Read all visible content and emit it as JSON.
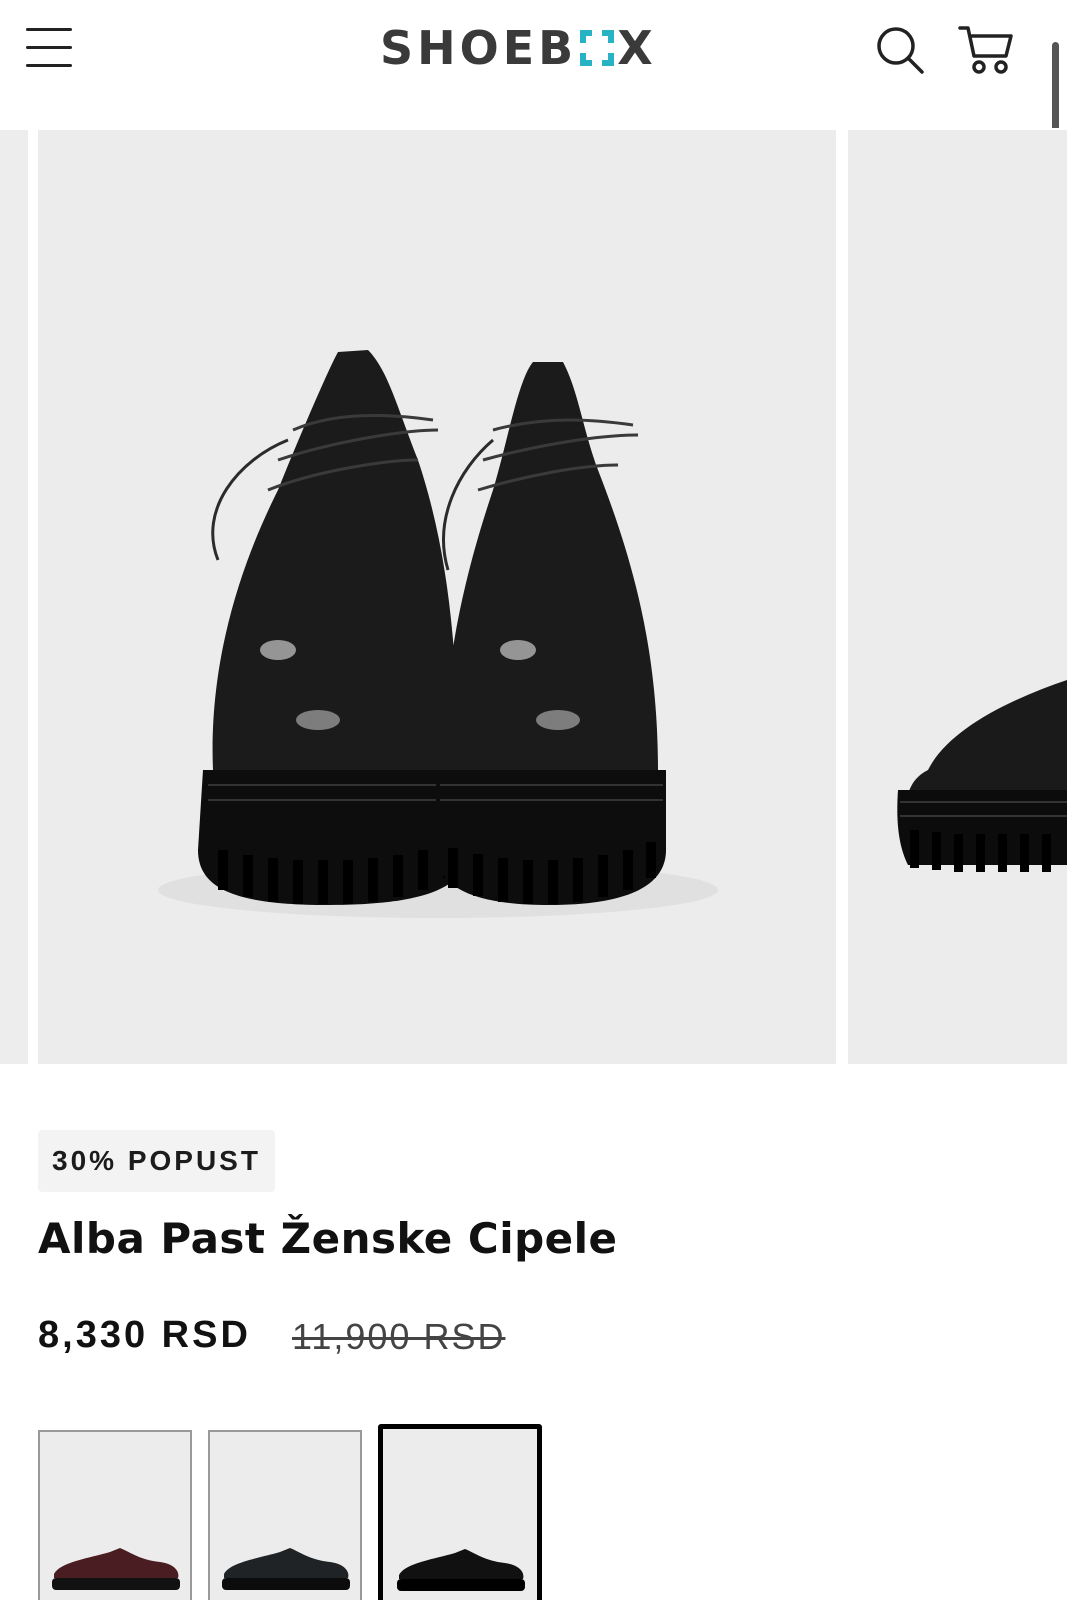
{
  "header": {
    "logo_left": "SHOEB",
    "logo_right": "X",
    "icons": {
      "menu": "hamburger-menu-icon",
      "search": "search-icon",
      "cart": "shopping-cart-icon"
    },
    "logo_accent_color": "#27b3c3"
  },
  "gallery": {
    "current_slide_alt": "Alba Past Ženske Cipele – black patent lace-up shoes",
    "next_slide_alt": "Alba Past Ženske Cipele – side view"
  },
  "product": {
    "discount_badge": "30% POPUST",
    "title": "Alba Past Ženske Cipele",
    "price": "8,330 RSD",
    "original_price": "11,900 RSD"
  },
  "variants": {
    "items": [
      {
        "color": "#4a1d22",
        "selected": false
      },
      {
        "color": "#1f2326",
        "selected": false
      },
      {
        "color": "#111111",
        "selected": true
      }
    ]
  }
}
